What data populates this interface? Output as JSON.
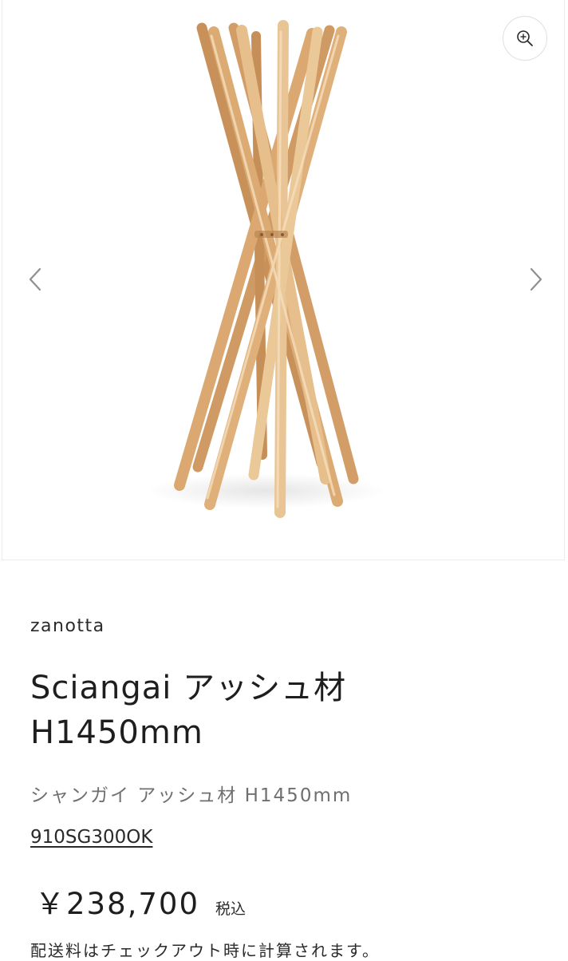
{
  "gallery": {
    "image_alt": "Sciangai coat stand",
    "zoom_icon": "zoom-in-icon",
    "prev_icon": "chevron-left-icon",
    "next_icon": "chevron-right-icon"
  },
  "product": {
    "vendor": "zanotta",
    "title_line1": "Sciangai アッシュ材",
    "title_line2": "H1450mm",
    "subtitle": "シャンガイ アッシュ材 H1450mm",
    "sku": "910SG300OK",
    "price": "￥238,700",
    "tax_label": "税込",
    "shipping_note": "配送料はチェックアウト時に計算されます。"
  },
  "colors": {
    "wood_light": "#e8c395",
    "wood_mid": "#d9a872",
    "wood_dark": "#c48a55",
    "text": "#1e1e1e",
    "muted_text": "#6f6f6f"
  }
}
